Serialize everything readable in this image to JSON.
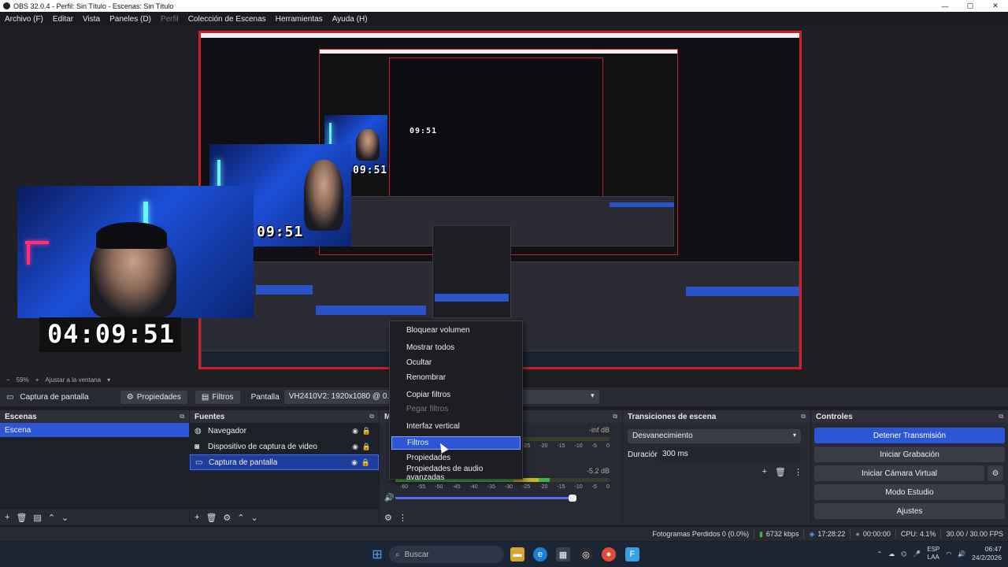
{
  "window": {
    "title": "OBS 32.0.4 - Perfil: Sin Título - Escenas: Sin Título",
    "controls": {
      "minimize": "—",
      "maximize": "▢",
      "close": "✕"
    }
  },
  "menubar": {
    "items": [
      "Archivo (F)",
      "Editar",
      "Vista",
      "Paneles (D)",
      "Perfil",
      "Colección de Escenas",
      "Herramientas",
      "Ayuda (H)"
    ]
  },
  "preview": {
    "clocks": [
      "04:09:51",
      "09:51",
      "09:51",
      "09:51"
    ],
    "zoom": {
      "percent": "59%",
      "fit": "Ajustar a la ventana"
    }
  },
  "source_toolbar": {
    "source_name": "Captura de pantalla",
    "properties": "Propiedades",
    "filters": "Filtros",
    "display_label": "Pantalla",
    "display_value": "VH2410V2: 1920x1080 @ 0.0 (Monitor pri"
  },
  "scenes": {
    "title": "Escenas",
    "items": [
      {
        "label": "Escena",
        "selected": true
      }
    ]
  },
  "sources": {
    "title": "Fuentes",
    "items": [
      {
        "label": "Navegador",
        "icon": "globe-icon"
      },
      {
        "label": "Dispositivo de captura de video",
        "icon": "camera-icon"
      },
      {
        "label": "Captura de pantalla",
        "icon": "monitor-icon",
        "selected": true
      }
    ]
  },
  "mixer": {
    "title": "M",
    "channels": [
      {
        "db": "-inf dB",
        "level": 0.0
      },
      {
        "db": "-5.2 dB",
        "level": 0.72
      }
    ],
    "ticks": [
      "-60",
      "-55",
      "-50",
      "-45",
      "-40",
      "-35",
      "-30",
      "-25",
      "-20",
      "-15",
      "-10",
      "-5",
      "0"
    ],
    "volume": 0.96
  },
  "transitions": {
    "title": "Transiciones de escena",
    "selected": "Desvanecimiento",
    "duration_label": "Duración",
    "duration_value": "300 ms"
  },
  "controls": {
    "title": "Controles",
    "buttons": [
      "Detener Transmisión",
      "Iniciar Grabación",
      "Iniciar Cámara Virtual",
      "Modo Estudio",
      "Ajustes"
    ]
  },
  "context_menu": {
    "items": [
      {
        "label": "Bloquear volumen"
      },
      {
        "label": "Mostrar todos"
      },
      {
        "label": "Ocultar"
      },
      {
        "label": "Renombrar"
      },
      {
        "label": "Copiar filtros"
      },
      {
        "label": "Pegar filtros",
        "disabled": true
      },
      {
        "label": "Interfaz vertical"
      },
      {
        "label": "Filtros",
        "active": true
      },
      {
        "label": "Propiedades"
      },
      {
        "label": "Propiedades de audio avanzadas"
      }
    ]
  },
  "status": {
    "dropped": "Fotogramas Perdidos 0 (0.0%)",
    "bitrate": "6732 kbps",
    "stream_time": "17:28:22",
    "rec_time": "00:00:00",
    "cpu": "CPU: 4.1%",
    "fps": "30.00 / 30.00 FPS"
  },
  "taskbar": {
    "search": "Buscar",
    "lang_top": "ESP",
    "lang_bottom": "LAA",
    "time": "06:47",
    "date": "24/2/2026"
  },
  "colors": {
    "accent": "#2c56d6",
    "recording_border": "#d21e2a",
    "panel": "#272a33"
  }
}
